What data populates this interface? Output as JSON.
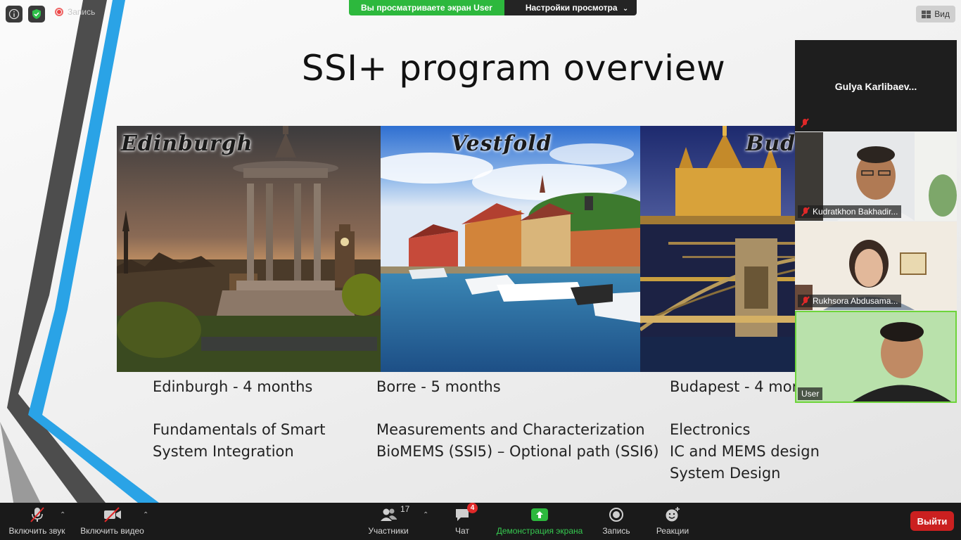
{
  "top_bar": {
    "recording_label": "Запись",
    "share_banner_text": "Вы просматриваете экран User",
    "view_options_label": "Настройки просмотра",
    "view_label": "Вид"
  },
  "slide": {
    "title": "SSI+ program overview",
    "photos": [
      {
        "caption": "Edinburgh"
      },
      {
        "caption": "Vestfold"
      },
      {
        "caption": "Bud"
      }
    ],
    "cities": [
      {
        "duration": "Edinburgh - 4 months",
        "courses": [
          "Fundamentals of Smart",
          "System Integration"
        ]
      },
      {
        "duration": "Borre - 5 months",
        "courses": [
          "Measurements and Characterization",
          "BioMEMS (SSI5) – Optional path (SSI6)"
        ]
      },
      {
        "duration": "Budapest - 4 mor",
        "courses": [
          "Electronics",
          "IC and MEMS design",
          "System Design"
        ]
      }
    ]
  },
  "participants_panel": {
    "tiles": [
      {
        "name": "Gulya  Karlibaev..."
      },
      {
        "name": "Kudratkhon Bakhadir..."
      },
      {
        "name": "Rukhsora Abdusama..."
      },
      {
        "name": "User"
      }
    ]
  },
  "toolbar": {
    "unmute_label": "Включить звук",
    "start_video_label": "Включить видео",
    "participants_label": "Участники",
    "participants_count": "17",
    "chat_label": "Чат",
    "chat_badge": "4",
    "share_screen_label": "Демонстрация экрана",
    "record_label": "Запись",
    "reactions_label": "Реакции",
    "end_label": "Выйти"
  },
  "colors": {
    "share_green": "#2db83d",
    "end_red": "#cb2020",
    "active_speaker_border": "#6ed43a"
  }
}
